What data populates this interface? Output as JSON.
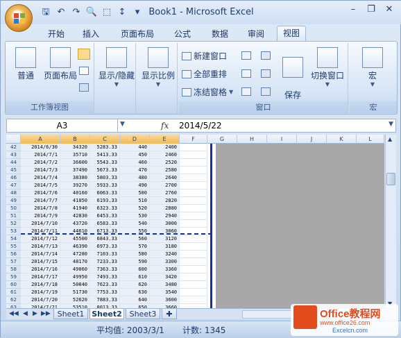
{
  "window": {
    "title": "Book1 - Microsoft Excel"
  },
  "tabs": [
    "开始",
    "插入",
    "页面布局",
    "公式",
    "数据",
    "审阅",
    "视图"
  ],
  "active_tab": "视图",
  "ribbon": {
    "group1": {
      "label": "工作簿视图",
      "normal": "普通",
      "page_layout": "页面布局"
    },
    "group2": {
      "show_hide": "显示/隐藏"
    },
    "group3": {
      "zoom": "显示比例"
    },
    "group4": {
      "label": "窗口",
      "new_window": "新建窗口",
      "arrange_all": "全部重排",
      "freeze_panes": "冻结窗格",
      "save_workspace": "保存\n工作区",
      "switch_windows": "切换窗口"
    },
    "group5": {
      "label": "宏",
      "macros": "宏"
    }
  },
  "formula_bar": {
    "name_box": "A3",
    "fx": "fx",
    "value": "2014/5/22"
  },
  "columns": [
    "A",
    "B",
    "C",
    "D",
    "E",
    "F",
    "G",
    "H",
    "I",
    "J",
    "K",
    "L"
  ],
  "rows": [
    {
      "n": "42",
      "a": "2014/6/30",
      "b": "34320",
      "c": "5283.33",
      "d": "440",
      "e": "2400"
    },
    {
      "n": "43",
      "a": "2014/7/1",
      "b": "35710",
      "c": "5413.33",
      "d": "450",
      "e": "2460"
    },
    {
      "n": "44",
      "a": "2014/7/2",
      "b": "36600",
      "c": "5543.33",
      "d": "460",
      "e": "2520"
    },
    {
      "n": "45",
      "a": "2014/7/3",
      "b": "37490",
      "c": "5673.33",
      "d": "470",
      "e": "2580"
    },
    {
      "n": "46",
      "a": "2014/7/4",
      "b": "38380",
      "c": "5803.33",
      "d": "480",
      "e": "2640"
    },
    {
      "n": "47",
      "a": "2014/7/5",
      "b": "39270",
      "c": "5933.33",
      "d": "490",
      "e": "2700"
    },
    {
      "n": "48",
      "a": "2014/7/6",
      "b": "40160",
      "c": "6063.33",
      "d": "500",
      "e": "2760"
    },
    {
      "n": "49",
      "a": "2014/7/7",
      "b": "41050",
      "c": "6193.33",
      "d": "510",
      "e": "2820"
    },
    {
      "n": "50",
      "a": "2014/7/8",
      "b": "41940",
      "c": "6323.33",
      "d": "520",
      "e": "2880"
    },
    {
      "n": "51",
      "a": "2014/7/9",
      "b": "42830",
      "c": "6453.33",
      "d": "530",
      "e": "2940"
    },
    {
      "n": "52",
      "a": "2014/7/10",
      "b": "43720",
      "c": "6583.33",
      "d": "540",
      "e": "3000"
    },
    {
      "n": "53",
      "a": "2014/7/11",
      "b": "44610",
      "c": "6713.33",
      "d": "550",
      "e": "3060"
    },
    {
      "n": "54",
      "a": "2014/7/12",
      "b": "45500",
      "c": "6843.33",
      "d": "560",
      "e": "3120"
    },
    {
      "n": "55",
      "a": "2014/7/13",
      "b": "46390",
      "c": "6973.33",
      "d": "570",
      "e": "3180"
    },
    {
      "n": "56",
      "a": "2014/7/14",
      "b": "47280",
      "c": "7103.33",
      "d": "580",
      "e": "3240"
    },
    {
      "n": "57",
      "a": "2014/7/15",
      "b": "48170",
      "c": "7233.33",
      "d": "590",
      "e": "3300"
    },
    {
      "n": "58",
      "a": "2014/7/16",
      "b": "49060",
      "c": "7363.33",
      "d": "600",
      "e": "3360"
    },
    {
      "n": "59",
      "a": "2014/7/17",
      "b": "49950",
      "c": "7493.33",
      "d": "610",
      "e": "3420"
    },
    {
      "n": "60",
      "a": "2014/7/18",
      "b": "50840",
      "c": "7623.33",
      "d": "620",
      "e": "3480"
    },
    {
      "n": "61",
      "a": "2014/7/19",
      "b": "51730",
      "c": "7753.33",
      "d": "630",
      "e": "3540"
    },
    {
      "n": "62",
      "a": "2014/7/20",
      "b": "52620",
      "c": "7883.33",
      "d": "640",
      "e": "3600"
    },
    {
      "n": "63",
      "a": "2014/7/21",
      "b": "53510",
      "c": "8013.33",
      "d": "650",
      "e": "3660"
    }
  ],
  "sheet_tabs": [
    "Sheet1",
    "Sheet2",
    "Sheet3"
  ],
  "active_sheet": "Sheet2",
  "status": {
    "average": "平均值: 2003/3/1",
    "count": "计数: 1345"
  },
  "watermark": {
    "title": "Office教程网",
    "url": "www.office26.com",
    "site": "Excelcn.com"
  }
}
